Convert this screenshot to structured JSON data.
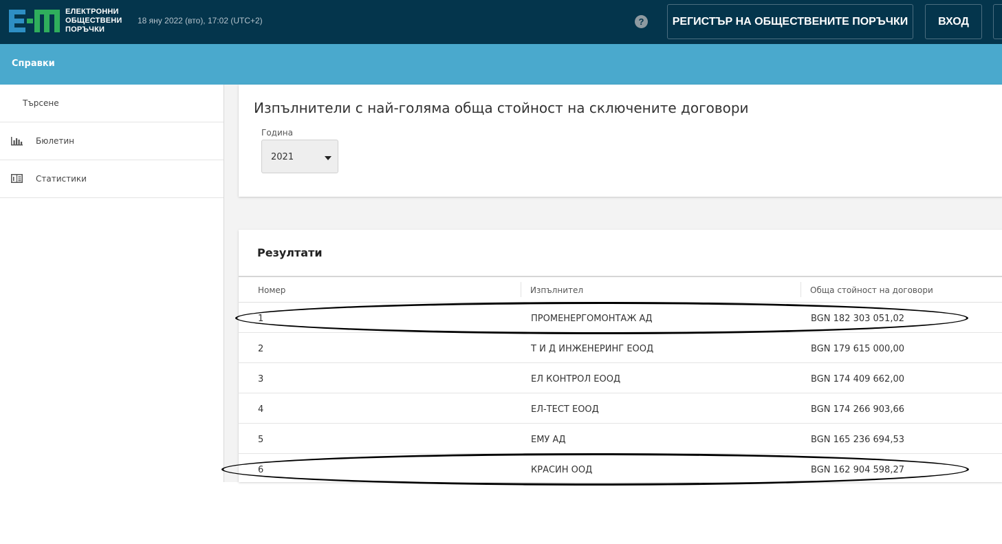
{
  "header": {
    "logo_lines": [
      "ЕЛЕКТРОННИ",
      "ОБЩЕСТВЕНИ",
      "ПОРЪЧКИ"
    ],
    "datetime": "18 яну 2022 (вто), 17:02 (UTC+2)",
    "help_symbol": "?",
    "register_button": "РЕГИСТЪР НА ОБЩЕСТВЕНИТЕ ПОРЪЧКИ",
    "login_button": "ВХОД"
  },
  "subheader": {
    "title": "Справки"
  },
  "sidebar": {
    "items": [
      {
        "label": "Търсене",
        "icon": ""
      },
      {
        "label": "Бюлетин",
        "icon": "bar-chart-icon"
      },
      {
        "label": "Статистики",
        "icon": "statistics-icon"
      }
    ]
  },
  "main": {
    "title": "Изпълнители с най-голяма обща стойност на сключените договори",
    "year_label": "Година",
    "year_value": "2021",
    "results_title": "Резултати",
    "columns": [
      "Номер",
      "Изпълнител",
      "Обща стойност на договори"
    ],
    "rows": [
      [
        "1",
        "ПРОМЕНЕРГОМОНТАЖ АД",
        "BGN 182 303 051,02"
      ],
      [
        "2",
        "Т И Д ИНЖЕНЕРИНГ ЕООД",
        "BGN 179 615 000,00"
      ],
      [
        "3",
        "ЕЛ КОНТРОЛ ЕООД",
        "BGN 174 409 662,00"
      ],
      [
        "4",
        "ЕЛ-ТЕСТ ЕООД",
        "BGN 174 266 903,66"
      ],
      [
        "5",
        "ЕМУ АД",
        "BGN 165 236 694,53"
      ],
      [
        "6",
        "КРАСИН ООД",
        "BGN 162 904 598,27"
      ]
    ]
  },
  "colors": {
    "topbar": "#04354c",
    "subbar": "#4aa9cd",
    "logo_blue": "#2e8fc4",
    "logo_green": "#2fae5c"
  }
}
